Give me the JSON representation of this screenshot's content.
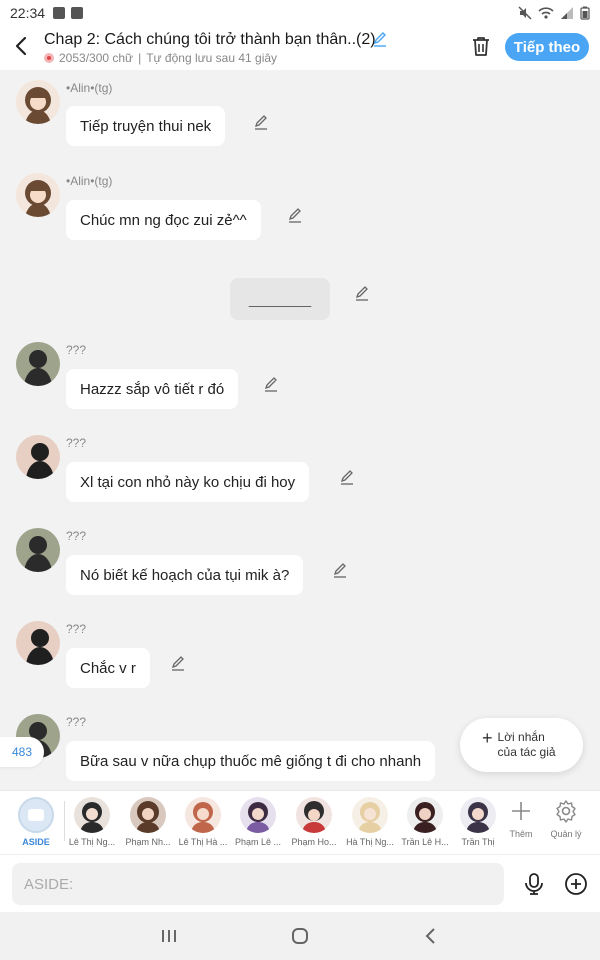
{
  "status_bar": {
    "time": "22:34"
  },
  "header": {
    "title": "Chap 2: Cách chúng tôi trở thành bạn thân..(2)",
    "word_count": "2053/300 chữ",
    "autosave": "Tự động lưu sau 41 giây",
    "next_label": "Tiếp theo",
    "accent_color": "#4aa6f5"
  },
  "messages": [
    {
      "sender": "•Alin•(tg)",
      "text": "Tiếp truyện thui nek",
      "avatar": "girl-avatar"
    },
    {
      "sender": "•Alin•(tg)",
      "text": "Chúc mn ng đọc zui zẻ^^",
      "avatar": "girl-avatar"
    },
    {
      "narration": "________"
    },
    {
      "sender": "???",
      "text": "Hazzz sắp vô tiết r đó",
      "avatar": "silhouette-green"
    },
    {
      "sender": "???",
      "text": "Xl tại con nhỏ này ko chịu đi hoy",
      "avatar": "silhouette-pink"
    },
    {
      "sender": "???",
      "text": "Nó biết kế hoạch của tụi mik à?",
      "avatar": "silhouette-green"
    },
    {
      "sender": "???",
      "text": "Chắc v r",
      "avatar": "silhouette-pink"
    },
    {
      "sender": "???",
      "text": "Bữa sau v nữa chụp thuốc mê giống t đi cho nhanh",
      "avatar": "silhouette-green"
    }
  ],
  "count_badge": "483",
  "author_note": {
    "line1": "Lời nhắn",
    "line2": "của tác giả"
  },
  "characters": {
    "aside": "ASIDE",
    "list": [
      "Lê Thị Ng...",
      "Phạm Nh...",
      "Lê Thị Hà ...",
      "Phạm Lê ...",
      "Phạm Ho...",
      "Hà Thị Ng...",
      "Trần Lê H...",
      "Trần Thị"
    ],
    "add_label": "Thêm",
    "manage_label": "Quản lý"
  },
  "input": {
    "placeholder": "ASIDE:"
  }
}
